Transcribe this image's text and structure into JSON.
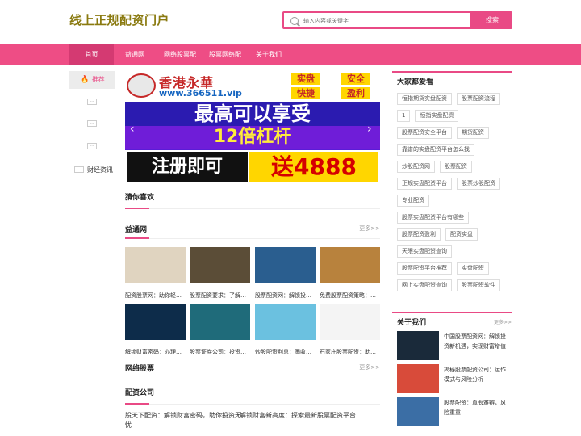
{
  "header": {
    "logo": "线上正规配资门户",
    "search_placeholder": "输入内容或关键字",
    "search_button": "搜索"
  },
  "nav": {
    "items": [
      "首页",
      "益通网",
      "网络股票配",
      "股票网络配",
      "关于我们"
    ]
  },
  "sidebar": {
    "recommend": "推荐",
    "dots": [
      "···",
      "···",
      "···"
    ],
    "last_label": "财经资讯"
  },
  "banner": {
    "name": "香港永華",
    "url": "www.366511.vip",
    "tags": [
      "实盘",
      "安全",
      "快捷",
      "盈利"
    ],
    "line1": "最高可以享受",
    "line2": "12倍杠杆",
    "line3a": "注册即可",
    "line3b": "送4888"
  },
  "main": {
    "guess_title": "猜你喜欢",
    "section1_title": "益通网",
    "section1_more": "更多>>",
    "thumbs": [
      {
        "caption": "配资股票网：助你轻松…",
        "color": "#e0d4c0"
      },
      {
        "caption": "股票配资要求：了解…",
        "color": "#5b4d37"
      },
      {
        "caption": "股票配资网：解锁投…",
        "color": "#2a5e8f"
      },
      {
        "caption": "免费股票配资策略：…",
        "color": "#b8823d"
      },
      {
        "caption": "解锁财富密码：办理…",
        "color": "#0d2c4a"
      },
      {
        "caption": "股票证卷公司：投资…",
        "color": "#1f6b7a"
      },
      {
        "caption": "炒股配资利息：画收…",
        "color": "#6bc1e0"
      },
      {
        "caption": "石家庄股票配资：助…",
        "color": "#f4f4f4"
      }
    ],
    "section2_title": "网络股票",
    "section2_more": "更多>>",
    "section3_title": "配资公司",
    "news": [
      "股天下配资：解锁财富密码，助你投资无忧",
      "解锁财富新高度：探索最新股票配资平台"
    ]
  },
  "right": {
    "hot_title": "大家都爱看",
    "tags": [
      "恒指期货实盘配资",
      "股票配资流程",
      "1",
      "恒指实盘配资",
      "股票配资安全平台",
      "期货配资",
      "靠谱的实盘配资平台怎么找",
      "炒股配资网",
      "股票配资",
      "正规实盘配资平台",
      "股票炒股配资",
      "专业配资",
      "股票实盘配资平台有哪些",
      "股票配资盈利",
      "配资实盘",
      "天眼实盘配资查询",
      "股票配资平台推荐",
      "实盘配资",
      "网上实盘配资查询",
      "股票配资软件"
    ],
    "about_title": "关于我们",
    "about_more": "更多>>",
    "about_items": [
      {
        "text": "中国股票配资网：解锁投资新机遇，实现财富增值",
        "color": "#1a2a3a"
      },
      {
        "text": "揭秘股票配资公司：运作模式与风险分析",
        "color": "#d84b3a"
      },
      {
        "text": "股票配资：真假难辨，风险重重",
        "color": "#3b6ea5"
      }
    ]
  }
}
